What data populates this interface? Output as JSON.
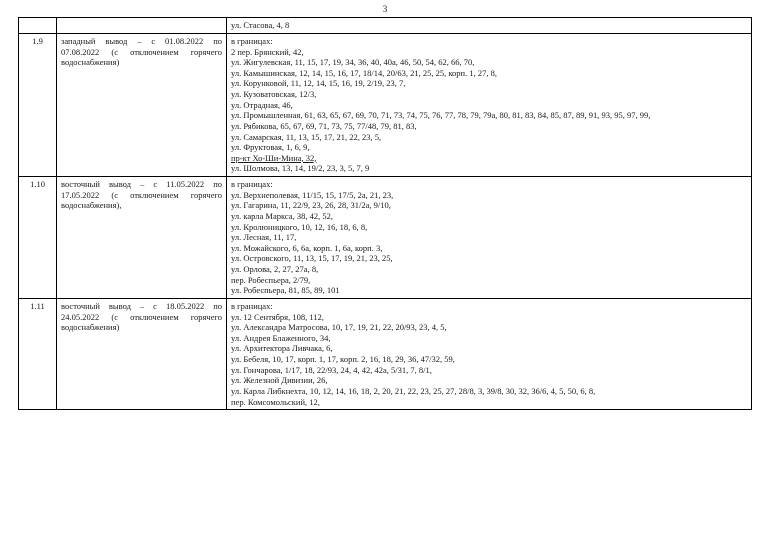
{
  "page_number": "3",
  "rows": [
    {
      "num": "",
      "desc": "",
      "lines": [
        {
          "text": "ул. Стасова, 4, 8"
        }
      ]
    },
    {
      "num": "1.9",
      "desc": "западный вывод – с 01.08.2022 по 07.08.2022 (с отключением горячего водоснабжения)",
      "lines": [
        {
          "text": "в границах:"
        },
        {
          "text": "2 пер. Брянский, 42,"
        },
        {
          "text": "ул. Жигулевская, 11, 15, 17, 19, 34, 36, 40, 40а, 46, 50, 54, 62, 66, 70,"
        },
        {
          "text": "ул. Камышинская, 12, 14, 15, 16, 17, 18/14, 20/63, 21, 25, 25, корп. 1, 27, 8,"
        },
        {
          "text": "ул. Корунковой, 11, 12, 14, 15, 16, 19, 2/19, 23, 7,"
        },
        {
          "text": "ул. Кузоватовская, 12/3,"
        },
        {
          "text": "ул. Отрадная, 46,"
        },
        {
          "text": "ул. Промышленная, 61, 63, 65, 67, 69, 70, 71, 73, 74, 75, 76, 77, 78, 79, 79а, 80, 81, 83, 84, 85, 87, 89, 91, 93, 95, 97, 99,"
        },
        {
          "text": "ул. Рябикова, 65, 67, 69, 71, 73, 75, 77/48, 79, 81, 83,"
        },
        {
          "text": "ул. Самарская, 11, 13, 15, 17, 21, 22, 23, 5,"
        },
        {
          "text": "ул. Фруктовая, 1, 6, 9,"
        },
        {
          "text": "пр-кт Хо-Ши-Мина, 32,",
          "underline": true
        },
        {
          "text": "ул. Шолмова, 13, 14, 19/2, 23, 3, 5, 7, 9"
        }
      ]
    },
    {
      "num": "1.10",
      "desc": "восточный вывод – с 11.05.2022 по 17.05.2022 (с отключением горячего водоснабжения),",
      "lines": [
        {
          "text": "в границах:"
        },
        {
          "text": "ул. Верхнеполевая, 11/15, 15, 17/5, 2а, 21, 23,"
        },
        {
          "text": "ул. Гагарина, 11, 22/9, 23, 26, 28, 31/2а, 9/10,"
        },
        {
          "text": "ул. карла Маркса, 38, 42, 52,"
        },
        {
          "text": "ул. Кролюницкого, 10, 12, 16, 18, 6, 8,"
        },
        {
          "text": "ул. Лесная, 11, 17,"
        },
        {
          "text": "ул. Можайского, 6, 6а, корп. 1, 6а, корп. 3,"
        },
        {
          "text": "ул. Островского, 11, 13, 15, 17, 19, 21, 23, 25,"
        },
        {
          "text": "ул. Орлова, 2, 27, 27а, 8,"
        },
        {
          "text": "пер. Робеспьера, 2/79,"
        },
        {
          "text": "ул. Робеспьера, 81, 85, 89, 101"
        }
      ]
    },
    {
      "num": "1.11",
      "desc": "восточный вывод – с 18.05.2022 по 24.05.2022 (с отключением горячего водоснабжения)",
      "lines": [
        {
          "text": "в границах:"
        },
        {
          "text": "ул. 12 Сентября, 108, 112,"
        },
        {
          "text": "ул. Александра Матросова, 10, 17, 19, 21, 22, 20/93, 23, 4, 5,"
        },
        {
          "text": "ул. Андрея Блаженного, 34,"
        },
        {
          "text": "ул. Архитектора Ливчака, 6,"
        },
        {
          "text": "ул. Бебеля, 10, 17, корп. 1, 17, корп. 2, 16, 18, 29, 36, 47/32, 59,"
        },
        {
          "text": "ул. Гончарова, 1/17, 18, 22/93, 24, 4, 42, 42а, 5/31, 7, 8/1,"
        },
        {
          "text": "ул. Железной Дивизии, 26,"
        },
        {
          "text": "ул. Карла Либкнехта, 10, 12, 14, 16, 18, 2, 20, 21, 22, 23, 25, 27, 28/8, 3, 39/8, 30, 32, 36/6, 4, 5, 50, 6, 8,"
        },
        {
          "text": "пер. Комсомольский, 12,"
        }
      ]
    }
  ]
}
